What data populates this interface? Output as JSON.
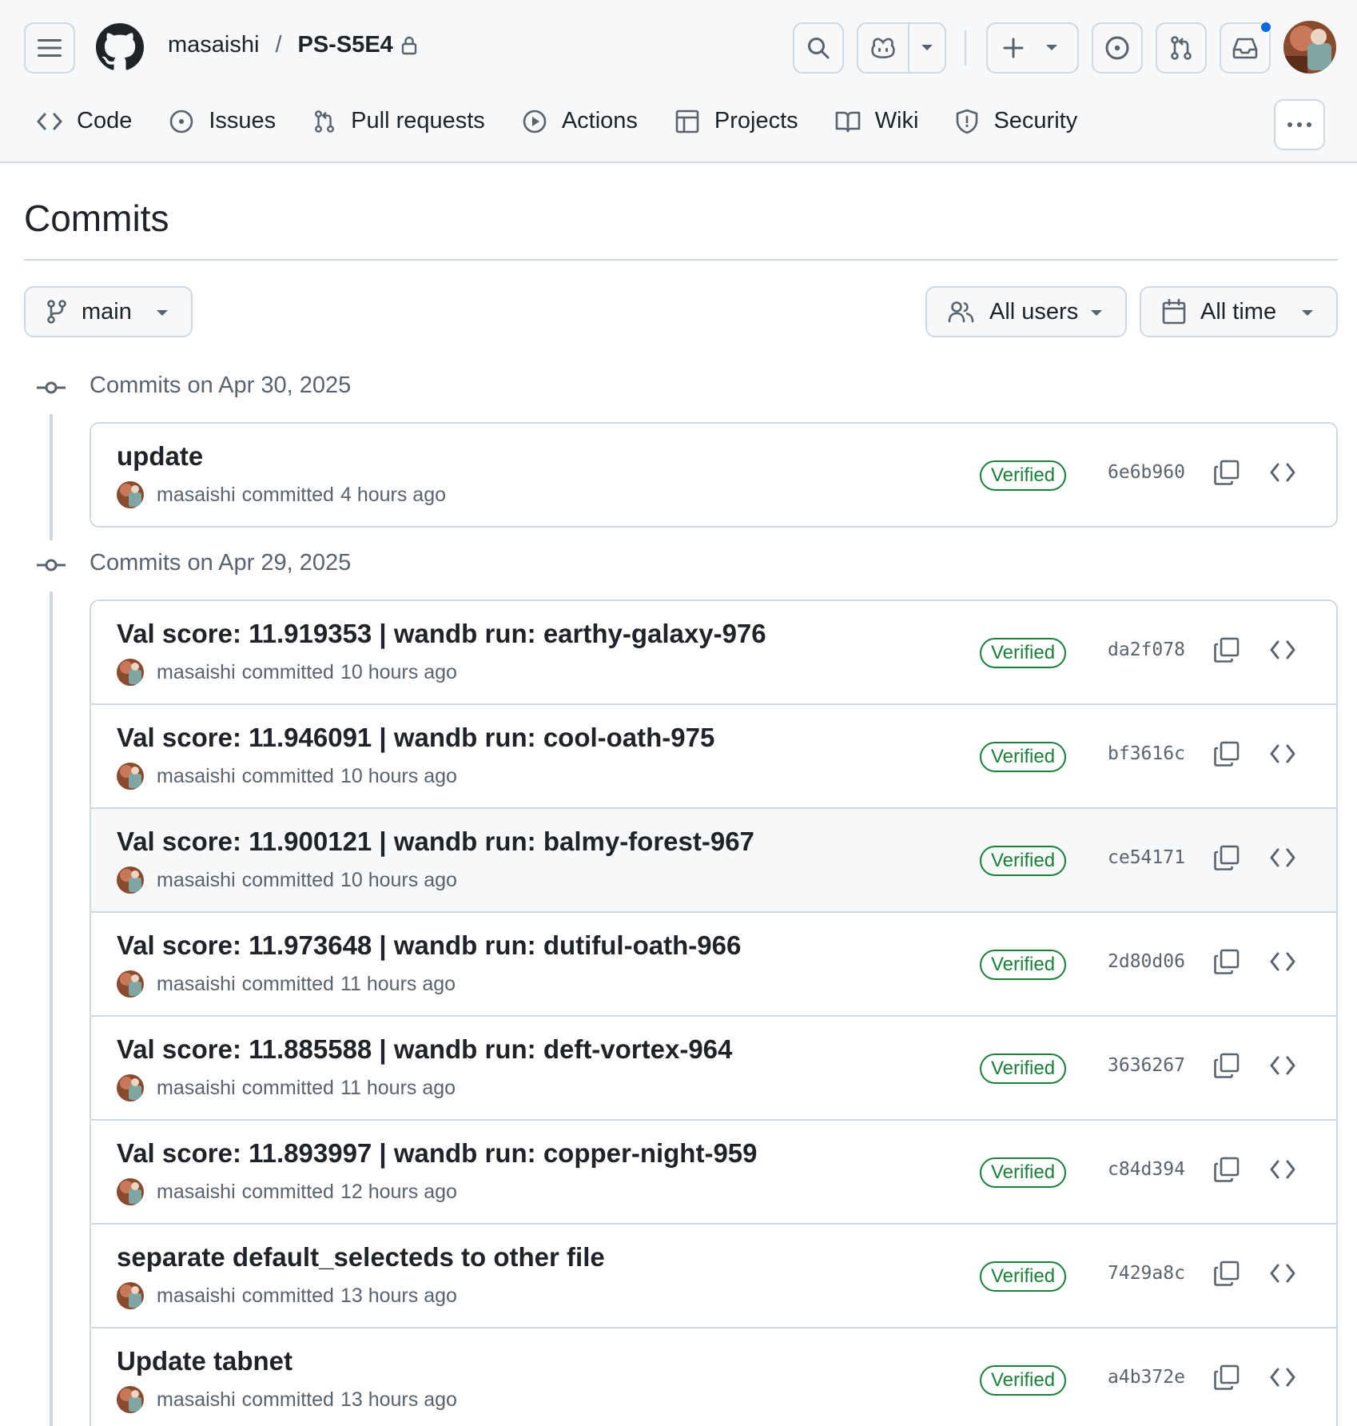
{
  "header": {
    "owner": "masaishi",
    "separator": "/",
    "repo": "PS-S5E4"
  },
  "nav": [
    {
      "label": "Code",
      "icon": "code-icon"
    },
    {
      "label": "Issues",
      "icon": "issue-opened-icon"
    },
    {
      "label": "Pull requests",
      "icon": "git-pull-request-icon"
    },
    {
      "label": "Actions",
      "icon": "play-icon"
    },
    {
      "label": "Projects",
      "icon": "table-icon"
    },
    {
      "label": "Wiki",
      "icon": "book-icon"
    },
    {
      "label": "Security",
      "icon": "shield-icon"
    }
  ],
  "page": {
    "title": "Commits",
    "branch": "main",
    "users_filter": "All users",
    "time_filter": "All time"
  },
  "groups": [
    {
      "label": "Commits on Apr 30, 2025",
      "commits": [
        {
          "message": "update",
          "author": "masaishi",
          "action": "committed",
          "time": "4 hours ago",
          "badge": "Verified",
          "sha": "6e6b960"
        }
      ]
    },
    {
      "label": "Commits on Apr 29, 2025",
      "commits": [
        {
          "message": "Val score: 11.919353 | wandb run: earthy-galaxy-976",
          "author": "masaishi",
          "action": "committed",
          "time": "10 hours ago",
          "badge": "Verified",
          "sha": "da2f078"
        },
        {
          "message": "Val score: 11.946091 | wandb run: cool-oath-975",
          "author": "masaishi",
          "action": "committed",
          "time": "10 hours ago",
          "badge": "Verified",
          "sha": "bf3616c"
        },
        {
          "message": "Val score: 11.900121 | wandb run: balmy-forest-967",
          "author": "masaishi",
          "action": "committed",
          "time": "10 hours ago",
          "badge": "Verified",
          "sha": "ce54171"
        },
        {
          "message": "Val score: 11.973648 | wandb run: dutiful-oath-966",
          "author": "masaishi",
          "action": "committed",
          "time": "11 hours ago",
          "badge": "Verified",
          "sha": "2d80d06"
        },
        {
          "message": "Val score: 11.885588 | wandb run: deft-vortex-964",
          "author": "masaishi",
          "action": "committed",
          "time": "11 hours ago",
          "badge": "Verified",
          "sha": "3636267"
        },
        {
          "message": "Val score: 11.893997 | wandb run: copper-night-959",
          "author": "masaishi",
          "action": "committed",
          "time": "12 hours ago",
          "badge": "Verified",
          "sha": "c84d394"
        },
        {
          "message": "separate default_selecteds to other file",
          "author": "masaishi",
          "action": "committed",
          "time": "13 hours ago",
          "badge": "Verified",
          "sha": "7429a8c"
        },
        {
          "message": "Update tabnet",
          "author": "masaishi",
          "action": "committed",
          "time": "13 hours ago",
          "badge": "Verified",
          "sha": "a4b372e"
        }
      ]
    }
  ],
  "colors": {
    "header_bg": "#f6f8fa",
    "border": "#d1d9e0",
    "verified": "#1a7f37",
    "notification": "#0969da",
    "muted_text": "#59636e"
  }
}
